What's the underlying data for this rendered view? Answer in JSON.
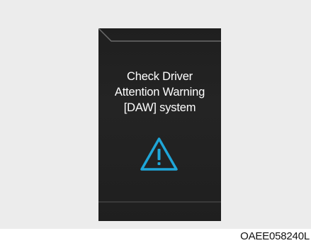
{
  "screen": {
    "message_lines": [
      "Check Driver",
      "Attention Warning",
      "[DAW] system"
    ],
    "icon": "warning-triangle-icon",
    "colors": {
      "screen_background": "#222222",
      "text": "#ffffff",
      "warning_icon": "#1fa6d8"
    }
  },
  "figure": {
    "code": "OAEE058240L"
  }
}
